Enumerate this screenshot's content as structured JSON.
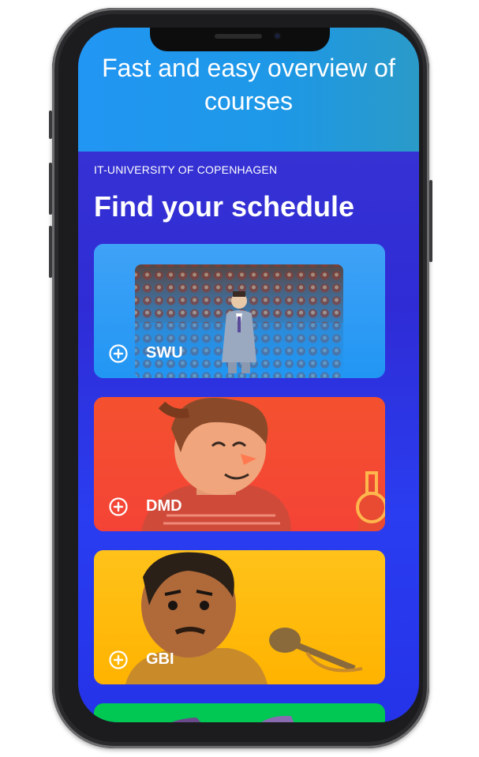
{
  "header": {
    "title": "Fast and easy overview of courses"
  },
  "university": "IT-UNIVERSITY OF COPENHAGEN",
  "schedule_title": "Find your schedule",
  "courses": [
    {
      "label": "SWU",
      "color": "#2196f3"
    },
    {
      "label": "DMD",
      "color": "#f44336"
    },
    {
      "label": "GBI",
      "color": "#ffc107"
    },
    {
      "color": "#00c853"
    }
  ],
  "icons": {
    "add": "plus-circle-icon"
  }
}
